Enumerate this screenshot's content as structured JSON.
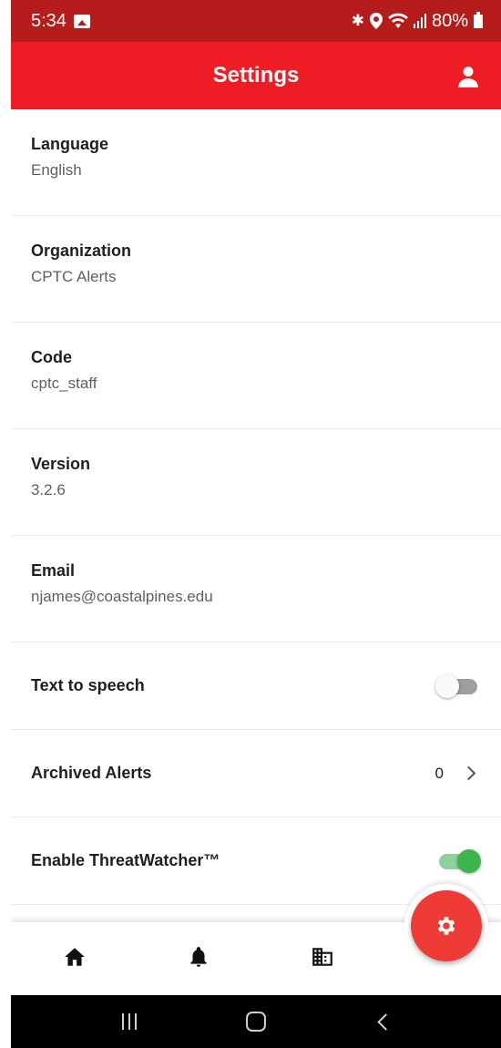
{
  "status_bar": {
    "time": "5:34",
    "battery": "80%",
    "icons": [
      "gallery-icon",
      "bluetooth-icon",
      "location-icon",
      "wifi-icon",
      "signal-icon",
      "battery-icon"
    ]
  },
  "app_bar": {
    "title": "Settings",
    "account_icon": "account-icon"
  },
  "settings": {
    "language": {
      "label": "Language",
      "value": "English"
    },
    "organization": {
      "label": "Organization",
      "value": "CPTC Alerts"
    },
    "code": {
      "label": "Code",
      "value": "cptc_staff"
    },
    "version": {
      "label": "Version",
      "value": "3.2.6"
    },
    "email": {
      "label": "Email",
      "value": "njames@coastalpines.edu"
    },
    "text_to_speech": {
      "label": "Text to speech",
      "enabled": false
    },
    "archived_alerts": {
      "label": "Archived Alerts",
      "count": "0"
    },
    "threatwatcher": {
      "label": "Enable ThreatWatcher™",
      "enabled": true
    }
  },
  "bottom_nav": {
    "items": [
      "home-icon",
      "bell-icon",
      "building-icon"
    ],
    "fab_icon": "gear-icon"
  },
  "colors": {
    "status_bar": "#b71c1c",
    "app_bar": "#ee1c24",
    "fab": "#ef3b36",
    "toggle_on": "#3cb54a",
    "toggle_off": "#9e9e9e"
  }
}
